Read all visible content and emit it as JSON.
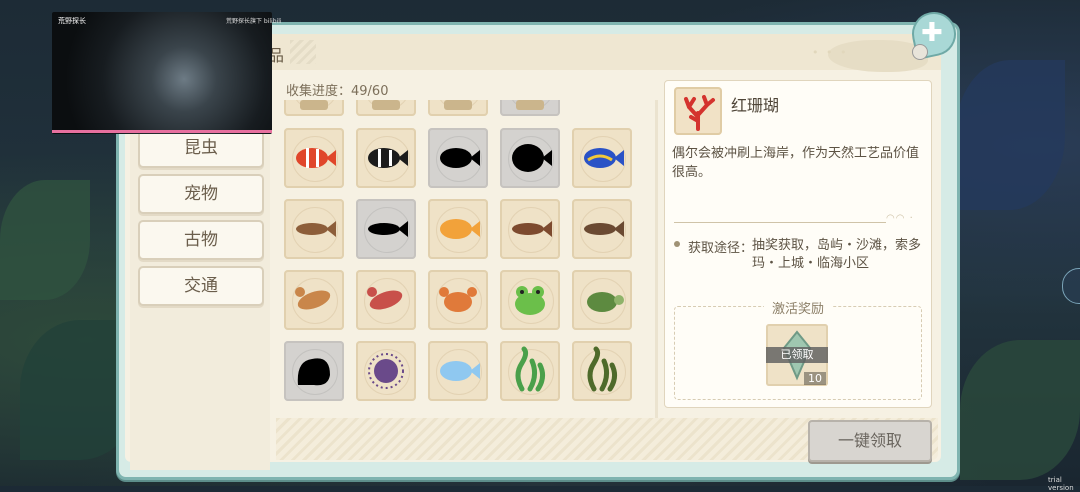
{
  "panel": {
    "title_fragment": "品"
  },
  "categories": [
    {
      "label": "昆虫"
    },
    {
      "label": "宠物"
    },
    {
      "label": "古物"
    },
    {
      "label": "交通"
    }
  ],
  "progress": {
    "label": "收集进度：49/60",
    "collected": 49,
    "total": 60
  },
  "grid": {
    "rows": [
      [
        {
          "item": "partial-top",
          "state": "normal"
        },
        {
          "item": "partial-top",
          "state": "normal"
        },
        {
          "item": "partial-top",
          "state": "normal"
        },
        {
          "item": "partial-top",
          "state": "gray"
        }
      ],
      [
        {
          "item": "clownfish",
          "state": "normal",
          "color": "#e0462a"
        },
        {
          "item": "black-striped-fish",
          "state": "normal",
          "color": "#1c1c1c"
        },
        {
          "item": "unknown-fish",
          "state": "locked",
          "color": "#000000"
        },
        {
          "item": "unknown-round-fish",
          "state": "locked",
          "color": "#000000"
        },
        {
          "item": "blue-tang",
          "state": "normal",
          "color": "#2a52c6"
        }
      ],
      [
        {
          "item": "catfish",
          "state": "normal",
          "color": "#8d5e3a"
        },
        {
          "item": "unknown-eel",
          "state": "locked",
          "color": "#000000"
        },
        {
          "item": "goldfish",
          "state": "normal",
          "color": "#f2a23a"
        },
        {
          "item": "arowana",
          "state": "normal",
          "color": "#7d4a2e"
        },
        {
          "item": "pike",
          "state": "normal",
          "color": "#6b4a32"
        }
      ],
      [
        {
          "item": "lobster",
          "state": "normal",
          "color": "#c9864a"
        },
        {
          "item": "squid",
          "state": "normal",
          "color": "#c8504a"
        },
        {
          "item": "crab",
          "state": "normal",
          "color": "#e07a3a"
        },
        {
          "item": "frog",
          "state": "normal",
          "color": "#6bbf4a"
        },
        {
          "item": "turtle",
          "state": "normal",
          "color": "#5d8a40"
        }
      ],
      [
        {
          "item": "unknown-coral",
          "state": "locked",
          "color": "#000000"
        },
        {
          "item": "sea-urchin",
          "state": "normal",
          "color": "#6a4a8a"
        },
        {
          "item": "jellyfish",
          "state": "normal",
          "color": "#8fc8f0"
        },
        {
          "item": "seaweed",
          "state": "normal",
          "color": "#4aa04a"
        },
        {
          "item": "kelp",
          "state": "normal",
          "color": "#4e6a2a"
        }
      ]
    ]
  },
  "detail": {
    "name": "红珊瑚",
    "icon": "red-coral-icon",
    "icon_color": "#d4332e",
    "description": "偶尔会被冲刷上海岸，作为天然工艺品价值很高。",
    "source_label": "获取途径：",
    "source_text": "抽奖获取，岛屿・沙滩，索多玛・上城・临海小区",
    "reward_title": "激活奖励",
    "reward_status": "已领取",
    "reward_count": "10"
  },
  "claim_all_label": "一键领取",
  "video": {
    "title": "荒野探长",
    "meta": "荒野探长旗下 bilibili"
  },
  "watermark": "trial version",
  "colors": {
    "frame": "#7fb4b0",
    "paper": "#f6f1e3",
    "cell": "#efe2c7",
    "locked_cell": "#d4d2cf"
  }
}
